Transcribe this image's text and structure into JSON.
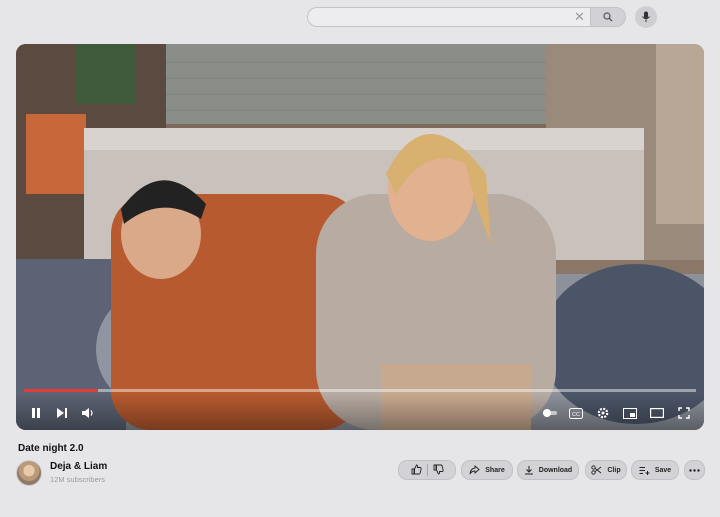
{
  "search": {
    "placeholder": "",
    "value": ""
  },
  "video": {
    "title": "Date night 2.0",
    "progress": 0.11
  },
  "channel": {
    "name": "Deja & Liam",
    "subscribers": "12M subscribers"
  },
  "actions": {
    "share_label": "Share",
    "download_label": "Download",
    "clip_label": "Clip",
    "save_label": "Save"
  },
  "colors": {
    "progress": "#e23b3b",
    "page_bg": "#e6e6e8",
    "pill_bg": "#d3d3d7"
  }
}
